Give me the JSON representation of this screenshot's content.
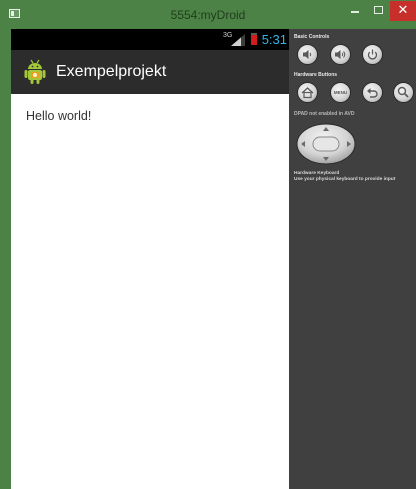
{
  "window": {
    "title": "5554:myDroid",
    "close_glyph": "✕"
  },
  "statusbar": {
    "network": "3G",
    "time": "5:31",
    "time_color": "#33b5e5",
    "battery_color": "#d21d1d"
  },
  "app": {
    "title": "Exempelprojekt",
    "icon": "android-icon",
    "content_text": "Hello world!"
  },
  "panel": {
    "basic_controls_label": "Basic Controls",
    "basic_controls": [
      "volume-down-icon",
      "volume-up-icon",
      "power-icon"
    ],
    "hardware_buttons_label": "Hardware Buttons",
    "hardware_buttons": [
      "home-icon",
      "menu-icon",
      "back-icon",
      "search-icon"
    ],
    "menu_label": "MENU",
    "dpad_label": "DPAD not enabled in AVD",
    "keyboard_label": "Hardware Keyboard",
    "keyboard_hint": "Use your physical keyboard to provide input"
  },
  "colors": {
    "window_frame": "#4d8246",
    "action_bar": "#2c2c2c",
    "panel_bg": "#404040",
    "close_button": "#c7302a"
  }
}
